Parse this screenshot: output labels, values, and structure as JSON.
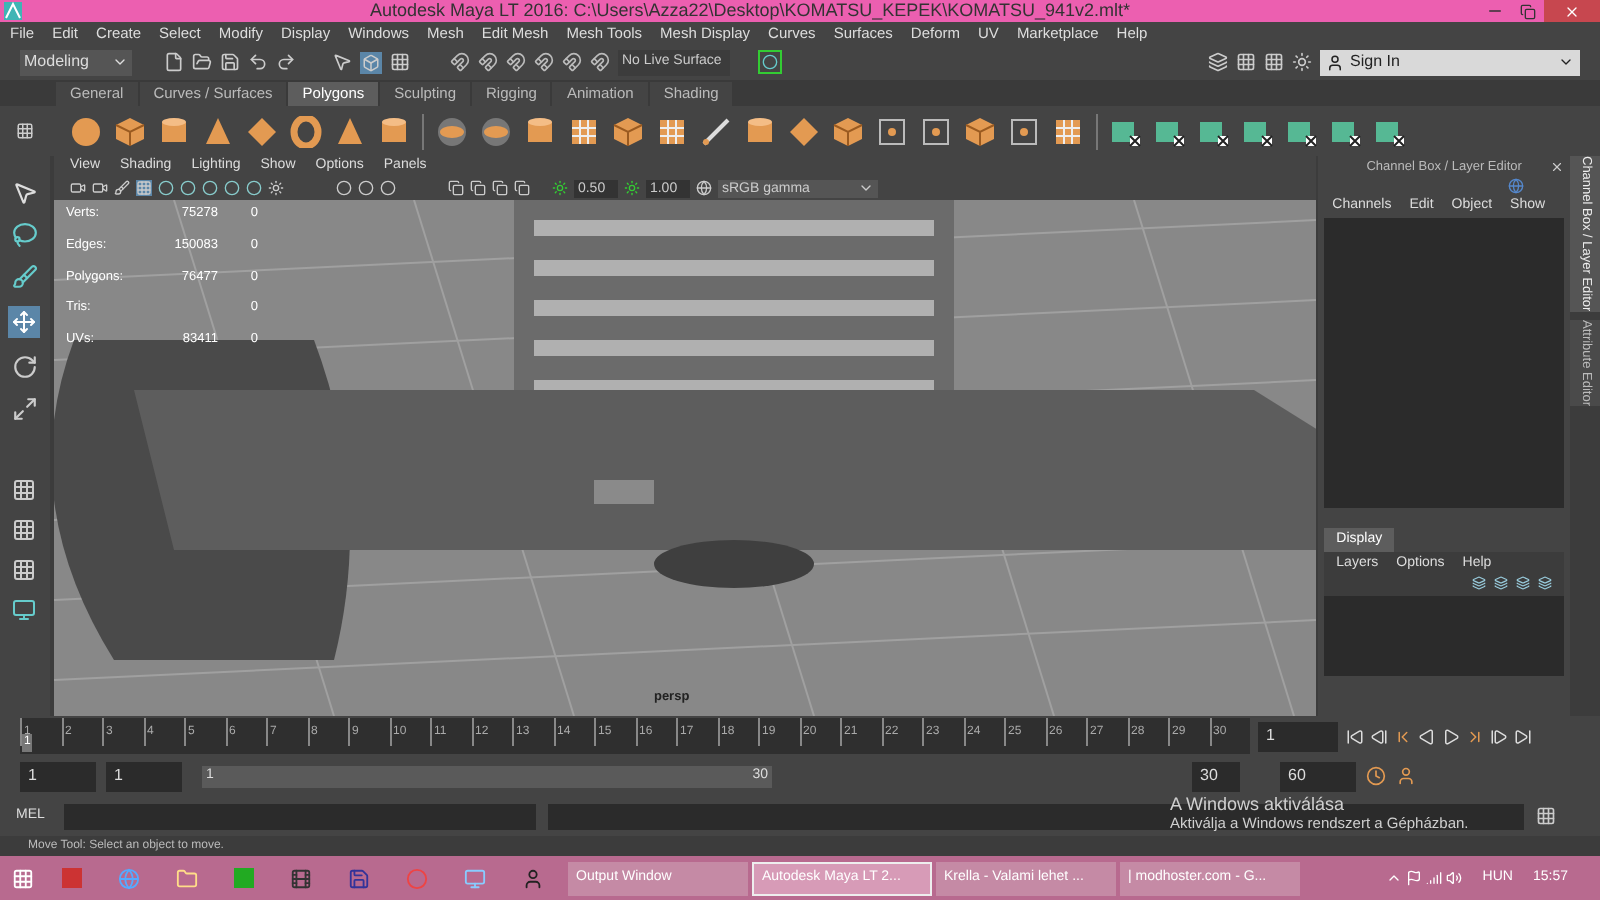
{
  "window": {
    "title": "Autodesk Maya LT 2016: C:\\Users\\Azza22\\Desktop\\KOMATSU_KEPEK\\KOMATSU_941v2.mlt*"
  },
  "menu_bar": [
    "File",
    "Edit",
    "Create",
    "Select",
    "Modify",
    "Display",
    "Windows",
    "Mesh",
    "Edit Mesh",
    "Mesh Tools",
    "Mesh Display",
    "Curves",
    "Surfaces",
    "Deform",
    "UV",
    "Marketplace",
    "Help"
  ],
  "status_line": {
    "mode": "Modeling",
    "live_surface": "No Live Surface",
    "sign_in": "Sign In"
  },
  "shelf_tabs": [
    {
      "label": "General",
      "selected": false
    },
    {
      "label": "Curves / Surfaces",
      "selected": false
    },
    {
      "label": "Polygons",
      "selected": true
    },
    {
      "label": "Sculpting",
      "selected": false
    },
    {
      "label": "Rigging",
      "selected": false
    },
    {
      "label": "Animation",
      "selected": false
    },
    {
      "label": "Shading",
      "selected": false
    }
  ],
  "viewport": {
    "menu": [
      "View",
      "Shading",
      "Lighting",
      "Show",
      "Options",
      "Panels"
    ],
    "exposure": "0.50",
    "gamma": "1.00",
    "color_space": "sRGB gamma",
    "hud": [
      {
        "label": "Verts:",
        "value": "75278",
        "selected": "0"
      },
      {
        "label": "Edges:",
        "value": "150083",
        "selected": "0"
      },
      {
        "label": "Polygons:",
        "value": "76477",
        "selected": "0"
      },
      {
        "label": "Tris:",
        "selected": "0"
      },
      {
        "label": "UVs:",
        "value": "83411",
        "selected": "0"
      }
    ],
    "camera": "persp"
  },
  "channel_box": {
    "title": "Channel Box / Layer Editor",
    "menu": [
      "Channels",
      "Edit",
      "Object",
      "Show"
    ]
  },
  "layer_editor": {
    "tab": "Display",
    "menu": [
      "Layers",
      "Options",
      "Help"
    ]
  },
  "side_tabs": [
    "Channel Box / Layer Editor",
    "Attribute Editor"
  ],
  "time_slider": {
    "ticks": [
      "1",
      "2",
      "3",
      "4",
      "5",
      "6",
      "7",
      "8",
      "9",
      "10",
      "11",
      "12",
      "13",
      "14",
      "15",
      "16",
      "17",
      "18",
      "19",
      "20",
      "21",
      "22",
      "23",
      "24",
      "25",
      "26",
      "27",
      "28",
      "29",
      "30"
    ],
    "current_frame": "1",
    "current_time": "1",
    "level": 0
  },
  "range_slider": {
    "start_time": "1",
    "playback_start": "1",
    "range_start": "1",
    "range_end": "30",
    "level": 1,
    "playback_end": "30",
    "end_time": "60"
  },
  "command_line": {
    "label": "MEL"
  },
  "help_line": "Move Tool: Select an object to move.",
  "activation_notice": {
    "title": "A Windows aktiválása",
    "message": "Aktiválja a Windows rendszert a Gépházban."
  },
  "taskbar": {
    "windows": [
      {
        "label": "Output Window",
        "selected": false
      },
      {
        "label": "Autodesk Maya LT 2...",
        "selected": true
      },
      {
        "label": "Krella - Valami lehet ...",
        "selected": false
      },
      {
        "label": "| modhoster.com - G...",
        "selected": false
      }
    ],
    "language": "HUN",
    "time": "15:57"
  }
}
